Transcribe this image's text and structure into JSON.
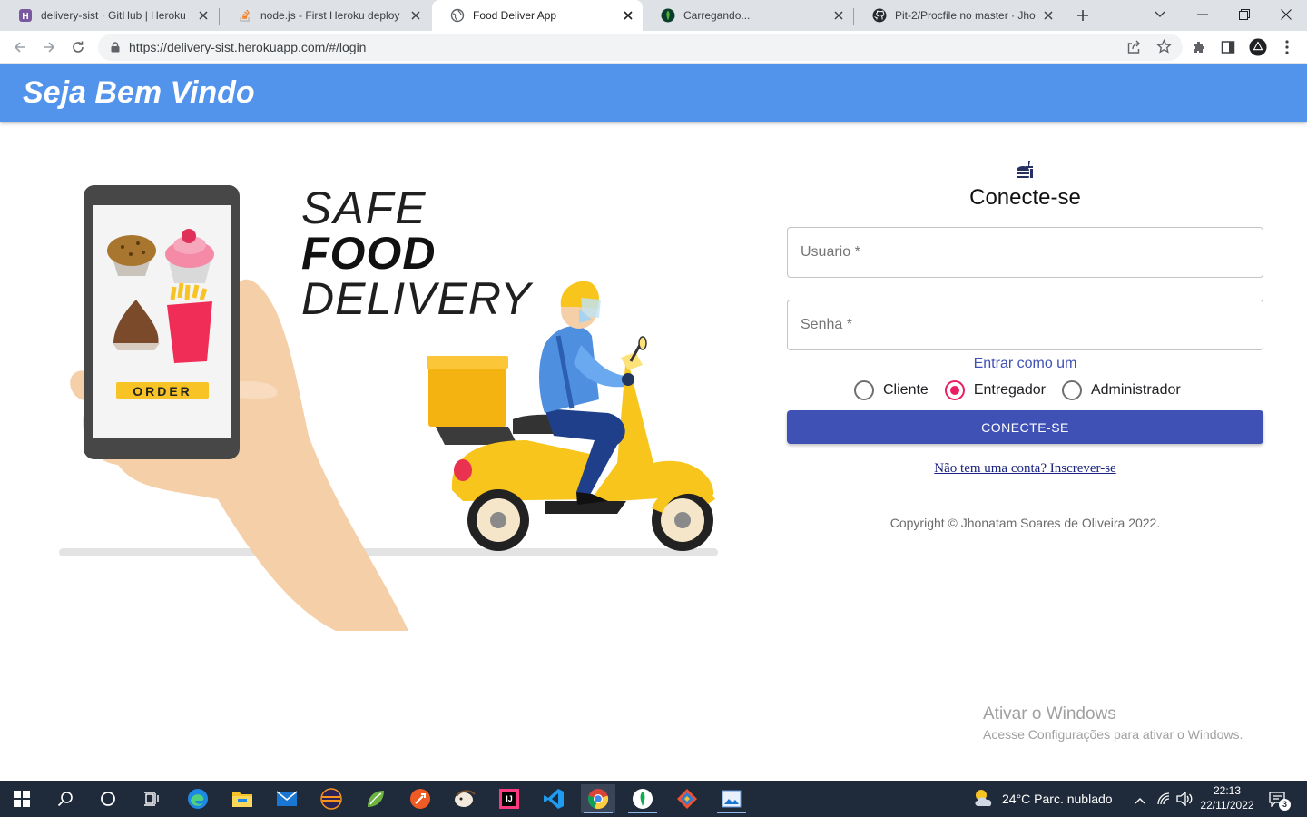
{
  "browser": {
    "tabs": [
      {
        "title": "delivery-sist · GitHub | Heroku",
        "icon": "heroku-icon",
        "active": false
      },
      {
        "title": "node.js - First Heroku deploy fa",
        "icon": "stackoverflow-icon",
        "active": false
      },
      {
        "title": "Food Deliver App",
        "icon": "globe-icon",
        "active": true
      },
      {
        "title": "Carregando...",
        "icon": "mongodb-icon",
        "active": false
      },
      {
        "title": "Pit-2/Procfile no master · Jhona",
        "icon": "github-icon",
        "active": false
      }
    ],
    "url": "https://delivery-sist.herokuapp.com/#/login"
  },
  "appbar": {
    "title": "Seja Bem Vindo"
  },
  "illustration": {
    "headline_1": "SAFE",
    "headline_2": "FOOD",
    "headline_3": "DELIVERY",
    "order_label": "ORDER"
  },
  "login": {
    "title": "Conecte-se",
    "username_label": "Usuario *",
    "password_label": "Senha *",
    "role_prompt": "Entrar como um",
    "roles": [
      {
        "label": "Cliente",
        "checked": false
      },
      {
        "label": "Entregador",
        "checked": true
      },
      {
        "label": "Administrador",
        "checked": false
      }
    ],
    "submit_label": "CONECTE-SE",
    "signup_link": "Não tem uma conta? Inscrever-se",
    "copyright": "Copyright © Jhonatam Soares de Oliveira 2022."
  },
  "watermark": {
    "title": "Ativar o Windows",
    "subtitle": "Acesse Configurações para ativar o Windows."
  },
  "taskbar": {
    "weather": "24°C  Parc. nublado",
    "time": "22:13",
    "date": "22/11/2022",
    "notifications": "3"
  },
  "colors": {
    "appbar": "#5293ec",
    "primary": "#3f51b5",
    "radio_checked": "#e91e63",
    "taskbar": "#1f2a3a"
  }
}
